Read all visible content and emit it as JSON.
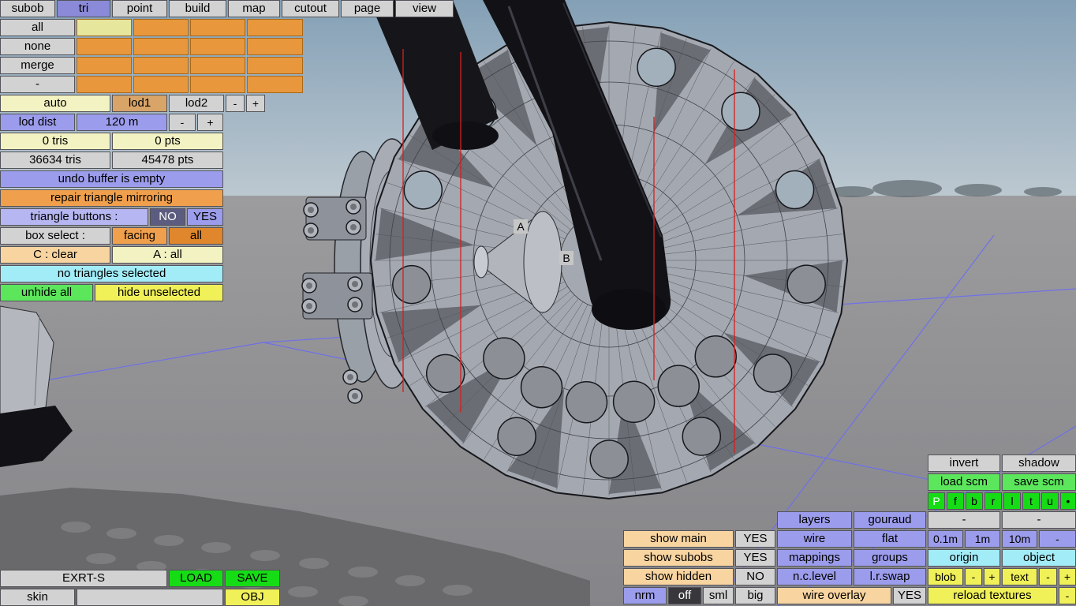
{
  "colors": {
    "selected_tab": "#8a8ad8",
    "purple": "#9c9cec",
    "orange": "#f0a04c",
    "cream": "#f2f2c2",
    "cyan": "#a2ecf8",
    "green": "#5ce65c",
    "bright_green": "#16dc16",
    "yellow": "#f0f058",
    "red_guide_line": "#d42020",
    "grid_line_blue": "#6c6cf2"
  },
  "tabs": {
    "subob": "subob",
    "tri": "tri",
    "point": "point",
    "build": "build",
    "map": "map",
    "cutout": "cutout",
    "page": "page",
    "view": "view"
  },
  "subob_panel": {
    "all": "all",
    "none": "none",
    "merge": "merge",
    "dash": "-"
  },
  "lod": {
    "auto": "auto",
    "lod1": "lod1",
    "lod2": "lod2",
    "minus": "-",
    "plus": "+",
    "dist_label": "lod dist",
    "dist_value": "120 m",
    "dist_minus": "-",
    "dist_plus": "+"
  },
  "stats": {
    "sel_tris": "0 tris",
    "sel_pts": "0 pts",
    "total_tris": "36634 tris",
    "total_pts": "45478 pts"
  },
  "actions": {
    "undo_status": "undo buffer is empty",
    "repair": "repair triangle mirroring",
    "triangle_buttons_label": "triangle buttons :",
    "triangle_no": "NO",
    "triangle_yes": "YES",
    "box_select_label": "box select :",
    "box_facing": "facing",
    "box_all": "all",
    "clear": "C : clear",
    "select_all": "A : all",
    "selection_status": "no triangles selected",
    "unhide_all": "unhide all",
    "hide_unselected": "hide unselected"
  },
  "viewport": {
    "marker_a": "A",
    "marker_b": "B"
  },
  "file_bar": {
    "filename": "EXRT-S",
    "load": "LOAD",
    "save": "SAVE",
    "skin": "skin",
    "skin_value": "",
    "obj": "OBJ"
  },
  "view_panel": {
    "invert": "invert",
    "shadow": "shadow",
    "load_scm": "load scm",
    "save_scm": "save scm",
    "proj_p": "P",
    "proj_f": "f",
    "proj_b": "b",
    "proj_r": "r",
    "proj_l": "l",
    "proj_t": "t",
    "proj_u": "u",
    "proj_dot": "•",
    "layers": "layers",
    "gouraud": "gouraud",
    "dash1": "-",
    "dash2": "-",
    "show_main": "show main",
    "show_main_value": "YES",
    "show_subobs": "show subobs",
    "show_subobs_value": "YES",
    "show_hidden": "show hidden",
    "show_hidden_value": "NO",
    "wire": "wire",
    "flat": "flat",
    "grid_01": "0.1m",
    "grid_1": "1m",
    "grid_10": "10m",
    "grid_dash": "-",
    "mappings": "mappings",
    "groups": "groups",
    "origin": "origin",
    "object": "object",
    "nc_level": "n.c.level",
    "lr_swap": "l.r.swap",
    "blob": "blob",
    "blob_minus": "-",
    "blob_plus": "+",
    "text": "text",
    "text_minus": "-",
    "text_plus": "+",
    "nrm": "nrm",
    "off": "off",
    "sml": "sml",
    "big": "big",
    "wire_overlay": "wire overlay",
    "wire_overlay_value": "YES",
    "reload_textures": "reload textures",
    "reload_minus": "-"
  }
}
